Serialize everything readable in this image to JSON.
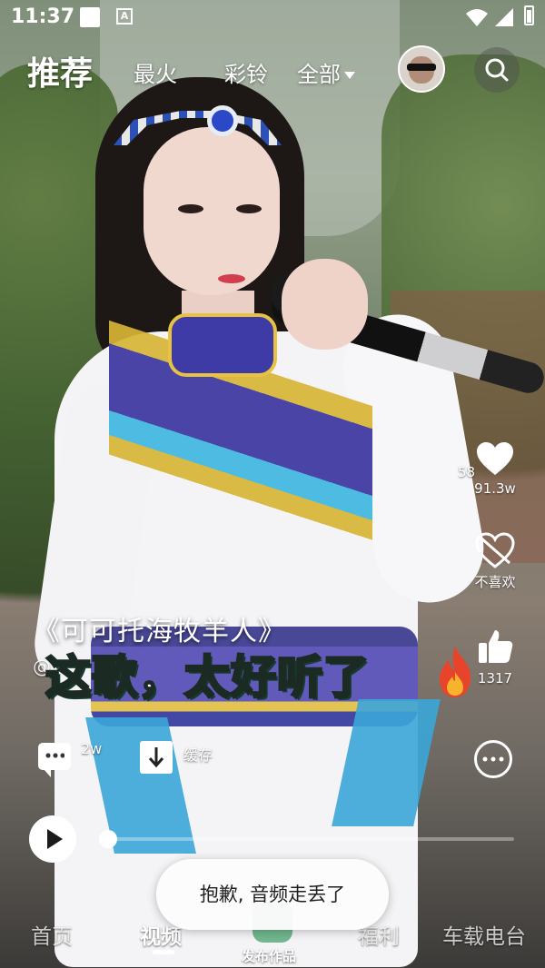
{
  "status_bar": {
    "time": "11:37"
  },
  "top_nav": {
    "tabs": [
      {
        "label": "推荐",
        "active": true
      },
      {
        "label": "最火",
        "active": false
      },
      {
        "label": "彩铃",
        "active": false
      },
      {
        "label": "全部",
        "active": false,
        "dropdown": true
      }
    ]
  },
  "right_rail": {
    "like_count_partial": "58",
    "like_count": "91.3w",
    "dislike_label": "不喜欢",
    "thumbs_up_count": "1317"
  },
  "video": {
    "song_title": "《可可托海牧羊人》",
    "author": "@",
    "caption": "这歌，太好听了"
  },
  "actions": {
    "comment_count": "2w",
    "cache_label": "缓存"
  },
  "progress": {
    "fraction": 0.02
  },
  "toast": {
    "text": "抱歉, 音频走丢了"
  },
  "bottom_nav": {
    "items": [
      {
        "label": "首页",
        "active": false
      },
      {
        "label": "视频",
        "active": true
      },
      {
        "label": "发布作品",
        "active": false
      },
      {
        "label": "福利",
        "active": false
      },
      {
        "label": "车载电台",
        "active": false
      }
    ]
  },
  "colors": {
    "accent": "#ffffff",
    "toast_bg": "#fcfcfc",
    "caption_stroke": "#1c2a24"
  }
}
